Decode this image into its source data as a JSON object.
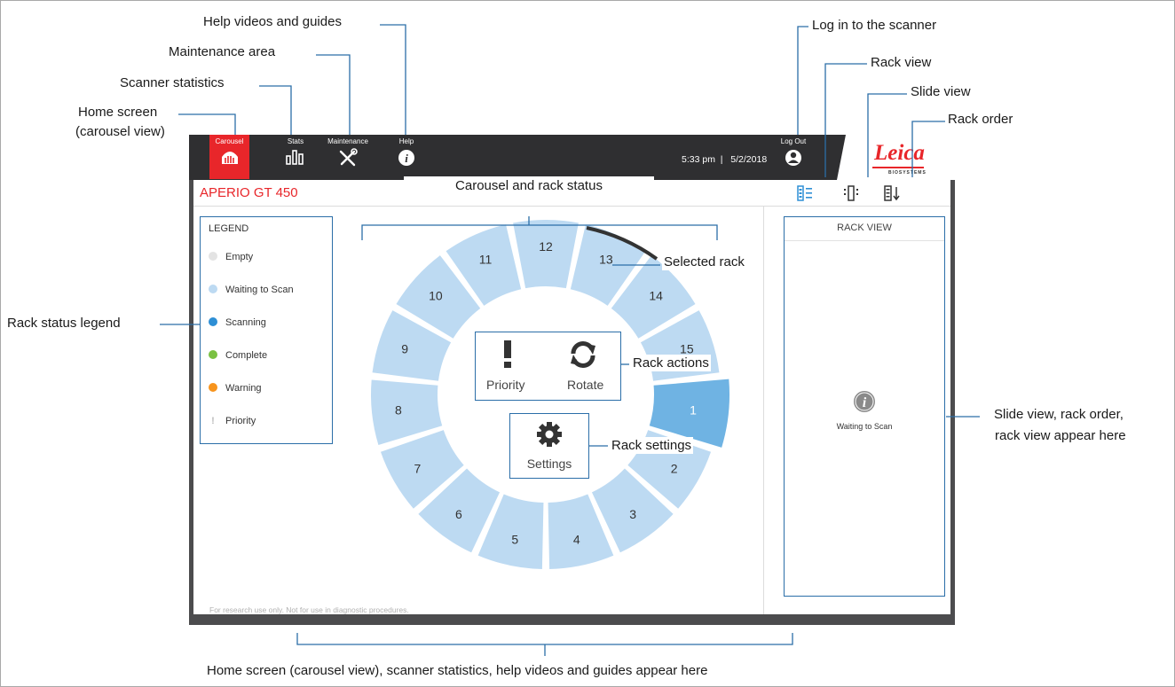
{
  "app": {
    "title": "APERIO GT 450",
    "time": "5:33 pm",
    "date": "5/2/2018",
    "nav": [
      {
        "label": "Carousel",
        "icon": "carousel-icon",
        "active": true
      },
      {
        "label": "Stats",
        "icon": "stats-icon",
        "active": false
      },
      {
        "label": "Maintenance",
        "icon": "maintenance-icon",
        "active": false
      },
      {
        "label": "Help",
        "icon": "help-icon",
        "active": false
      }
    ],
    "logout_label": "Log Out",
    "logo": {
      "brand": "Leica",
      "sub": "BIOSYSTEMS"
    },
    "view_icons": [
      "rack-view-icon",
      "slide-view-icon",
      "rack-order-icon"
    ],
    "accent_color": "#e8262a",
    "footnote": "For research use only. Not for use in diagnostic procedures."
  },
  "legend": {
    "title": "LEGEND",
    "items": [
      {
        "label": "Empty",
        "color": "#e3e3e3"
      },
      {
        "label": "Waiting to Scan",
        "color": "#bddaf2"
      },
      {
        "label": "Scanning",
        "color": "#2e8fd5"
      },
      {
        "label": "Complete",
        "color": "#7ac142"
      },
      {
        "label": "Warning",
        "color": "#f7941d"
      },
      {
        "label": "Priority",
        "color": "#bdbdbd",
        "icon": "exclamation-icon"
      }
    ]
  },
  "carousel": {
    "rack_labels": [
      "1",
      "2",
      "3",
      "4",
      "5",
      "6",
      "7",
      "8",
      "9",
      "10",
      "11",
      "12",
      "13",
      "14",
      "15"
    ],
    "selected_rack": "1",
    "highlighted_rack": "13",
    "rack_color": "#bddaf2",
    "selected_color": "#6fb3e3"
  },
  "actions": {
    "priority_label": "Priority",
    "rotate_label": "Rotate",
    "settings_label": "Settings"
  },
  "rack_view": {
    "title": "RACK VIEW",
    "status": "Waiting to Scan"
  },
  "callouts": {
    "help": "Help videos and guides",
    "maintenance": "Maintenance  area",
    "stats": "Scanner statistics",
    "home_line1": "Home screen",
    "home_line2": "(carousel view)",
    "login": "Log in to the scanner",
    "rack_view": "Rack view",
    "slide_view": "Slide view",
    "rack_order": "Rack order",
    "carousel_status": "Carousel and rack status",
    "selected_rack": "Selected rack",
    "rack_actions": "Rack actions",
    "rack_settings": "Rack settings",
    "legend": "Rack status legend",
    "right_line1": "Slide view, rack order,",
    "right_line2": "rack view appear here",
    "bottom": "Home screen (carousel view), scanner statistics, help videos and guides appear here"
  }
}
